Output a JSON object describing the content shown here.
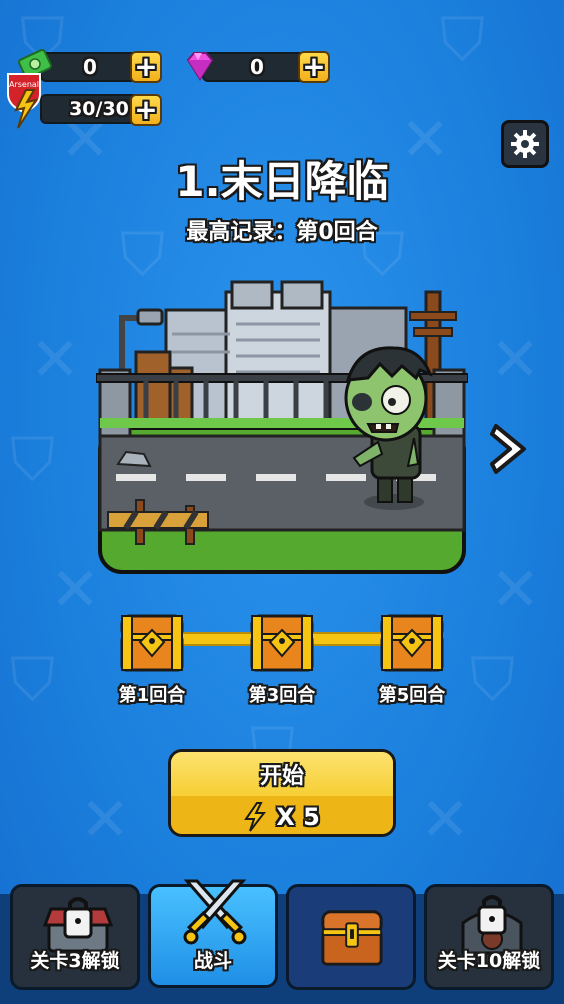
{
  "resources": {
    "cash": {
      "value": "0",
      "icon": "cash-icon"
    },
    "gems": {
      "value": "0",
      "icon": "gem-icon"
    },
    "energy": {
      "value": "30/30",
      "icon": "lightning-icon"
    },
    "badge_text": "Arsenal"
  },
  "level": {
    "title": "1.末日降临",
    "record": "最高记录：第0回合"
  },
  "rewards": {
    "rounds": [
      "第1回合",
      "第3回合",
      "第5回合"
    ]
  },
  "start_button": {
    "label": "开始",
    "cost": "X 5"
  },
  "bottom_nav": {
    "items": [
      {
        "label": "关卡3解锁",
        "state": "locked"
      },
      {
        "label": "战斗",
        "state": "active"
      },
      {
        "label": "",
        "state": "normal"
      },
      {
        "label": "关卡10解锁",
        "state": "locked"
      }
    ]
  },
  "colors": {
    "background": "#1f86e0",
    "accent_yellow": "#f6c514",
    "dark": "#1f2a33"
  }
}
